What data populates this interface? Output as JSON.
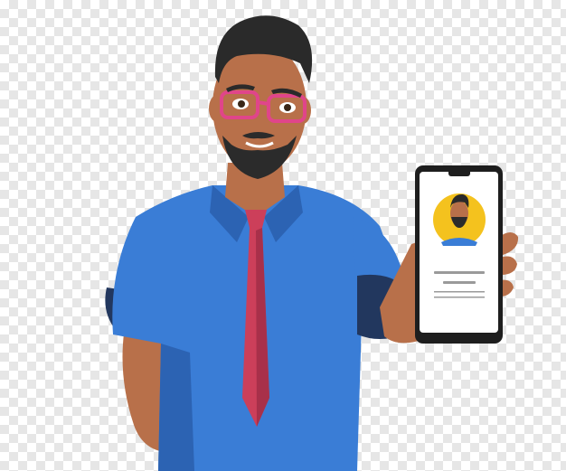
{
  "scene": {
    "colors": {
      "checker_light": "#ffffff",
      "checker_dark": "#e6e6e6",
      "skin": "#b8704a",
      "skin_shadow": "#9a5a3a",
      "hair": "#2a2a2a",
      "beard": "#2b2b2b",
      "glasses": "#e0458a",
      "shirt": "#3a7dd6",
      "shirt_shadow": "#2c63b3",
      "cuff": "#22375e",
      "tie": "#cc3f5a",
      "tie_shadow": "#a8304a",
      "phone_body": "#1e1e1e",
      "phone_screen": "#ffffff",
      "avatar_bg": "#f4c21e",
      "screen_lines": "#9a9a9a"
    },
    "icons": [
      "person-character",
      "smartphone-icon",
      "profile-avatar-icon",
      "text-line-placeholder"
    ]
  }
}
